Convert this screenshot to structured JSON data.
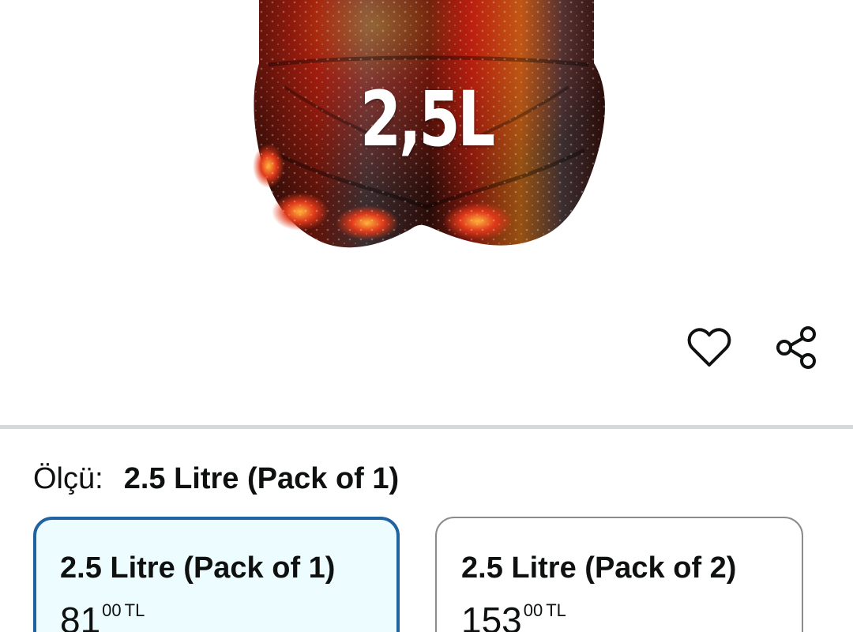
{
  "product": {
    "image_label": "2,5L",
    "colors": {
      "liquid_dark": "#2a0c08",
      "liquid_red": "#c0200f",
      "liquid_orange": "#f08a1a",
      "wet_grey": "#4a4a52"
    }
  },
  "actions": {
    "wishlist_icon": "heart-outline-icon",
    "share_icon": "share-icon"
  },
  "variation": {
    "label": "Ölçü:",
    "selected_value": "2.5 Litre (Pack of 1)",
    "options": [
      {
        "title": "2.5 Litre (Pack of 1)",
        "price_whole": "81",
        "price_fraction": "00",
        "currency": "TL",
        "selected": true
      },
      {
        "title": "2.5 Litre (Pack of 2)",
        "price_whole": "153",
        "price_fraction": "00",
        "currency": "TL",
        "selected": false
      }
    ]
  },
  "theme": {
    "selected_border": "#2162a1",
    "selected_bg": "#edfdff",
    "unselected_border": "#888c8c",
    "divider": "#d5d9d9",
    "text": "#0f1111"
  }
}
